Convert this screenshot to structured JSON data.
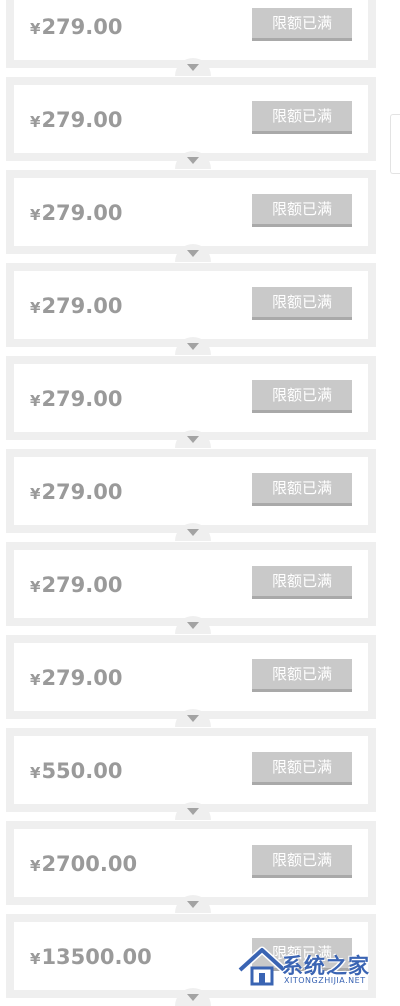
{
  "offers": [
    {
      "currency": "¥",
      "amount": "279.00",
      "status_label": "限额已满"
    },
    {
      "currency": "¥",
      "amount": "279.00",
      "status_label": "限额已满"
    },
    {
      "currency": "¥",
      "amount": "279.00",
      "status_label": "限额已满"
    },
    {
      "currency": "¥",
      "amount": "279.00",
      "status_label": "限额已满"
    },
    {
      "currency": "¥",
      "amount": "279.00",
      "status_label": "限额已满"
    },
    {
      "currency": "¥",
      "amount": "279.00",
      "status_label": "限额已满"
    },
    {
      "currency": "¥",
      "amount": "279.00",
      "status_label": "限额已满"
    },
    {
      "currency": "¥",
      "amount": "279.00",
      "status_label": "限额已满"
    },
    {
      "currency": "¥",
      "amount": "550.00",
      "status_label": "限额已满"
    },
    {
      "currency": "¥",
      "amount": "2700.00",
      "status_label": "限额已满"
    },
    {
      "currency": "¥",
      "amount": "13500.00",
      "status_label": "限额已满"
    }
  ],
  "watermark": {
    "text": "系统之家",
    "subtext": "XITONGZHIJIA.NET"
  },
  "icons": {
    "expand": "chevron-down-icon",
    "watermark_logo": "house-logo-icon"
  },
  "colors": {
    "card_border": "#efefef",
    "price_text": "#9a9a9a",
    "button_disabled": "#c9c9c9",
    "button_text": "#ffffff",
    "watermark": "#3a64b3"
  }
}
